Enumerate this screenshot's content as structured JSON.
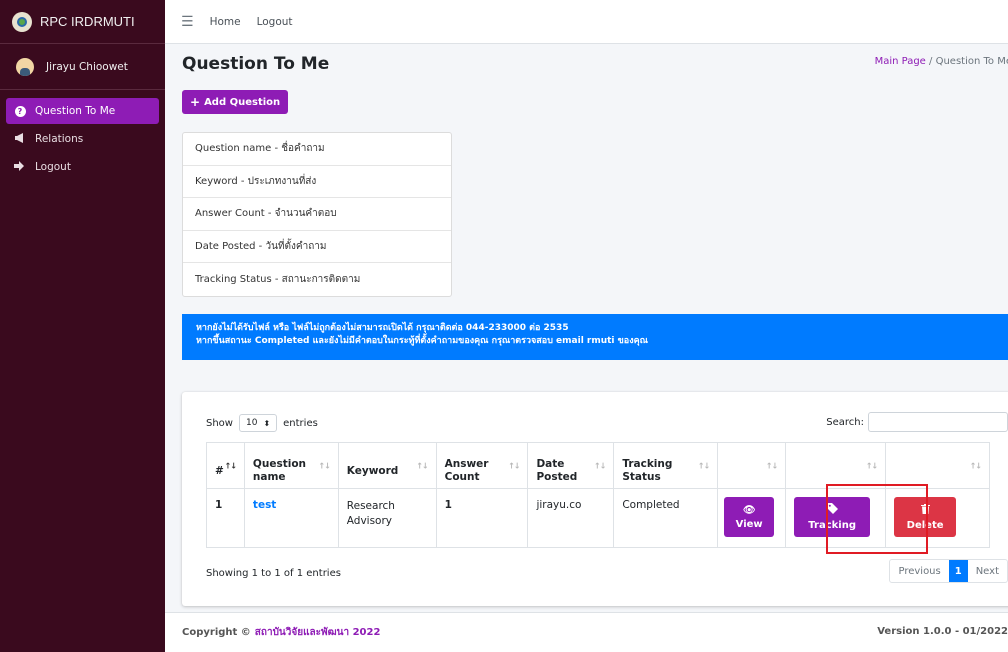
{
  "brand": {
    "name": "RPC IRDRMUTI"
  },
  "user": {
    "name": "Jirayu Chioowet"
  },
  "sidebar": {
    "items": [
      {
        "label": "Question To Me",
        "icon": "question-circle-icon",
        "active": true
      },
      {
        "label": "Relations",
        "icon": "megaphone-icon",
        "active": false
      },
      {
        "label": "Logout",
        "icon": "sign-out-icon",
        "active": false
      }
    ]
  },
  "topnav": {
    "home": "Home",
    "logout": "Logout"
  },
  "page": {
    "title": "Question To Me",
    "breadcrumb_home": "Main Page",
    "breadcrumb_sep": "/",
    "breadcrumb_current": "Question To Me",
    "add_button": "Add Question"
  },
  "legend": [
    "Question name - ชื่อคำถาม",
    "Keyword - ประเภทงานที่ส่ง",
    "Answer Count - จำนวนคำตอบ",
    "Date Posted - วันที่ตั้งคำถาม",
    "Tracking Status - สถานะการติดตาม"
  ],
  "alert": {
    "line1": "หากยังไม่ได้รับไฟล์ หรือ ไฟล์ไม่ถูกต้องไม่สามารถเปิดได้ กรุณาติดต่อ 044-233000 ต่อ 2535",
    "line2": "หากขึ้นสถานะ Completed และยังไม่มีคำตอบในกระทู้ที่ตั้งคำถามของคุณ กรุณาตรวจสอบ email rmuti ของคุณ"
  },
  "table": {
    "show_label": "Show",
    "entries_value": "10",
    "entries_label": "entries",
    "search_label": "Search:",
    "columns": [
      "#",
      "Question name",
      "Keyword",
      "Answer Count",
      "Date Posted",
      "Tracking Status"
    ],
    "rows": [
      {
        "num": "1",
        "question": "test",
        "keyword": "Research Advisory",
        "answer_count": "1",
        "posted_by": "jirayu.co",
        "status": "Completed"
      }
    ],
    "actions": {
      "view": "View",
      "tracking": "Tracking",
      "delete": "Delete"
    },
    "info": "Showing 1 to 1 of 1 entries",
    "pager": {
      "previous": "Previous",
      "current": "1",
      "next": "Next"
    }
  },
  "footer": {
    "copyright": "Copyright ©",
    "org": "สถาบันวิจัยและพัฒนา 2022",
    "version_label": "Version",
    "version_value": "1.0.0 - 01/2022"
  },
  "colors": {
    "sidebar_bg": "#3a0a1e",
    "accent": "#8e1cb5",
    "alert_bg": "#007bff",
    "danger": "#dc3545",
    "highlight_box": "#e01b24"
  }
}
